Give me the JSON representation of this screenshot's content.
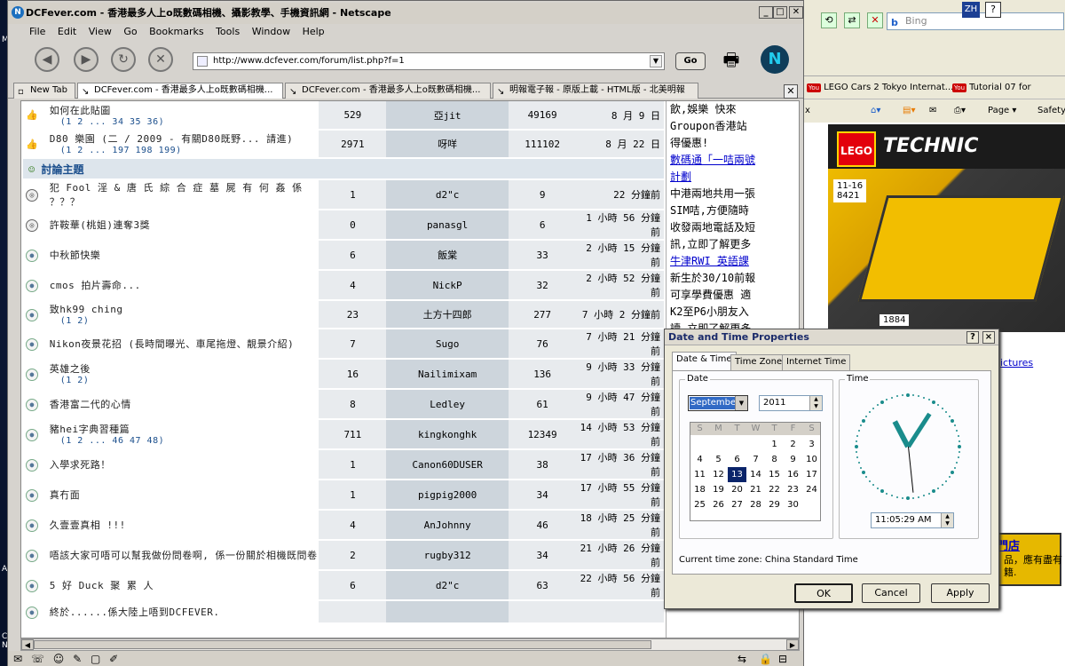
{
  "ie": {
    "search_placeholder": "Bing",
    "lang_button": "ZH",
    "favorites": [
      "LEGO Cars 2 Tokyo Internat...",
      "Tutorial 07 for Arduino I2"
    ],
    "yt_badge": "You",
    "tab_close": "x",
    "commands": [
      "Page ▾",
      "Safety ▾"
    ],
    "lego_age": "11-16",
    "lego_set": "8421",
    "lego_brand": "TECHNIC",
    "lego_logo": "LEGO",
    "lego_number": "1884",
    "link_pictures": "ictures",
    "link_store": "門店",
    "text1": "品，應有盡有",
    "text2": "籍."
  },
  "netscape": {
    "title": "DCFever.com - 香港最多人上o既數碼相機、攝影教學、手機資訊網 - Netscape",
    "menu": [
      "File",
      "Edit",
      "View",
      "Go",
      "Bookmarks",
      "Tools",
      "Window",
      "Help"
    ],
    "url": "http://www.dcfever.com/forum/list.php?f=1",
    "go_label": "Go",
    "tabs": [
      {
        "label": "New Tab",
        "active": false
      },
      {
        "label": "DCFever.com - 香港最多人上o既數碼相機...",
        "active": true
      },
      {
        "label": "DCFever.com - 香港最多人上o既數碼相機...",
        "active": false
      },
      {
        "label": "明報電子報 - 原版上載 - HTML版 - 北美明報",
        "active": false
      }
    ]
  },
  "forum": {
    "pinned": [
      {
        "title": "如何在此貼圖",
        "pages": "(1 2 ... 34 35 36)",
        "replies": "529",
        "author": "亞jit",
        "views": "49169",
        "date": "8 月 9 日"
      },
      {
        "title": "D80 樂園 (二 / 2009 - 有關D80既野... 請進)",
        "pages": "(1 2 ... 197 198 199)",
        "replies": "2971",
        "author": "呀咩",
        "views": "111102",
        "date": "8 月 22 日"
      }
    ],
    "section_title": "討論主題",
    "topics": [
      {
        "title": "犯 Fool 淫 & 唐 氏 綜 合 症 墓 屍 有 何 姦 係 ？？？",
        "pages": "",
        "replies": "1",
        "author": "d2\"c",
        "views": "9",
        "date": "22 分鐘前"
      },
      {
        "title": "許鞍華(桃姐)連奪3獎",
        "pages": "",
        "replies": "0",
        "author": "panasgl",
        "views": "6",
        "date": "1 小時 56 分鐘前"
      },
      {
        "title": "中秋節快樂",
        "pages": "",
        "replies": "6",
        "author": "飯棠",
        "views": "33",
        "date": "2 小時 15 分鐘前"
      },
      {
        "title": "cmos 拍片壽命...",
        "pages": "",
        "replies": "4",
        "author": "NickP",
        "views": "32",
        "date": "2 小時 52 分鐘前"
      },
      {
        "title": "致hk99 ching",
        "pages": "(1 2)",
        "replies": "23",
        "author": "土方十四郎",
        "views": "277",
        "date": "7 小時 2 分鐘前"
      },
      {
        "title": "Nikon夜景花招 (長時間曝光、車尾拖燈、靚景介紹)",
        "pages": "",
        "replies": "7",
        "author": "Sugo",
        "views": "76",
        "date": "7 小時 21 分鐘前"
      },
      {
        "title": "英雄之後",
        "pages": "(1 2)",
        "replies": "16",
        "author": "Nailimixam",
        "views": "136",
        "date": "9 小時 33 分鐘前"
      },
      {
        "title": "香港富二代的心情",
        "pages": "",
        "replies": "8",
        "author": "Ledley",
        "views": "61",
        "date": "9 小時 47 分鐘前"
      },
      {
        "title": "豬hei字典習種篇",
        "pages": "(1 2 ... 46 47 48)",
        "replies": "711",
        "author": "kingkonghk",
        "views": "12349",
        "date": "14 小時 53 分鐘前"
      },
      {
        "title": "入學求死路！",
        "pages": "",
        "replies": "1",
        "author": "Canon60DUSER",
        "views": "38",
        "date": "17 小時 36 分鐘前"
      },
      {
        "title": "真冇面",
        "pages": "",
        "replies": "1",
        "author": "pigpig2000",
        "views": "34",
        "date": "17 小時 55 分鐘前"
      },
      {
        "title": "久壹壹真相 !!!",
        "pages": "",
        "replies": "4",
        "author": "AnJohnny",
        "views": "46",
        "date": "18 小時 25 分鐘前"
      },
      {
        "title": "唔該大家可唔可以幫我做份問卷啊, 係一份關於相機既問卷",
        "pages": "",
        "replies": "2",
        "author": "rugby312",
        "views": "34",
        "date": "21 小時 26 分鐘前"
      },
      {
        "title": "5 好 Duck 聚 累 人",
        "pages": "",
        "replies": "6",
        "author": "d2\"c",
        "views": "63",
        "date": "22 小時 56 分鐘前"
      },
      {
        "title": "終於......係大陸上唔到DCFEVER.",
        "pages": "",
        "replies": "",
        "author": "",
        "views": "",
        "date": ""
      }
    ]
  },
  "sidebar": {
    "lines": [
      {
        "text": "飲,娛樂 快來",
        "link": false
      },
      {
        "text": "Groupon香港站",
        "link": false
      },
      {
        "text": "得優惠!",
        "link": false
      },
      {
        "text": "數碼通「一咭兩號",
        "link": true
      },
      {
        "text": "計劃",
        "link": true
      },
      {
        "text": "中港兩地共用一張",
        "link": false
      },
      {
        "text": "SIM咭,方便隨時",
        "link": false
      },
      {
        "text": "收發兩地電話及短",
        "link": false
      },
      {
        "text": "訊,立即了解更多",
        "link": false
      },
      {
        "text": "牛津RWI 英語課",
        "link": true
      },
      {
        "text": "新生於30/10前報",
        "link": false
      },
      {
        "text": "可享學費優惠 適",
        "link": false
      },
      {
        "text": "K2至P6小朋友入",
        "link": false
      },
      {
        "text": "讀,立即了解更多",
        "link": false
      }
    ]
  },
  "dialog": {
    "title": "Date and Time Properties",
    "help": "?",
    "close": "×",
    "tabs": [
      "Date & Time",
      "Time Zone",
      "Internet Time"
    ],
    "date_group": "Date",
    "time_group": "Time",
    "month": "September",
    "year": "2011",
    "weekdays": [
      "S",
      "M",
      "T",
      "W",
      "T",
      "F",
      "S"
    ],
    "days": [
      "",
      "",
      "",
      "",
      "1",
      "2",
      "3",
      "4",
      "5",
      "6",
      "7",
      "8",
      "9",
      "10",
      "11",
      "12",
      "13",
      "14",
      "15",
      "16",
      "17",
      "18",
      "19",
      "20",
      "21",
      "22",
      "23",
      "24",
      "25",
      "26",
      "27",
      "28",
      "29",
      "30"
    ],
    "selected_day": "13",
    "time": "11:05:29 AM",
    "clock": {
      "hour": 11,
      "minute": 5,
      "second": 29
    },
    "timezone": "Current time zone:  China Standard Time",
    "buttons": [
      "OK",
      "Cancel",
      "Apply"
    ]
  },
  "desktop_labels": [
    "My",
    "Ac",
    "Ci Ne"
  ]
}
